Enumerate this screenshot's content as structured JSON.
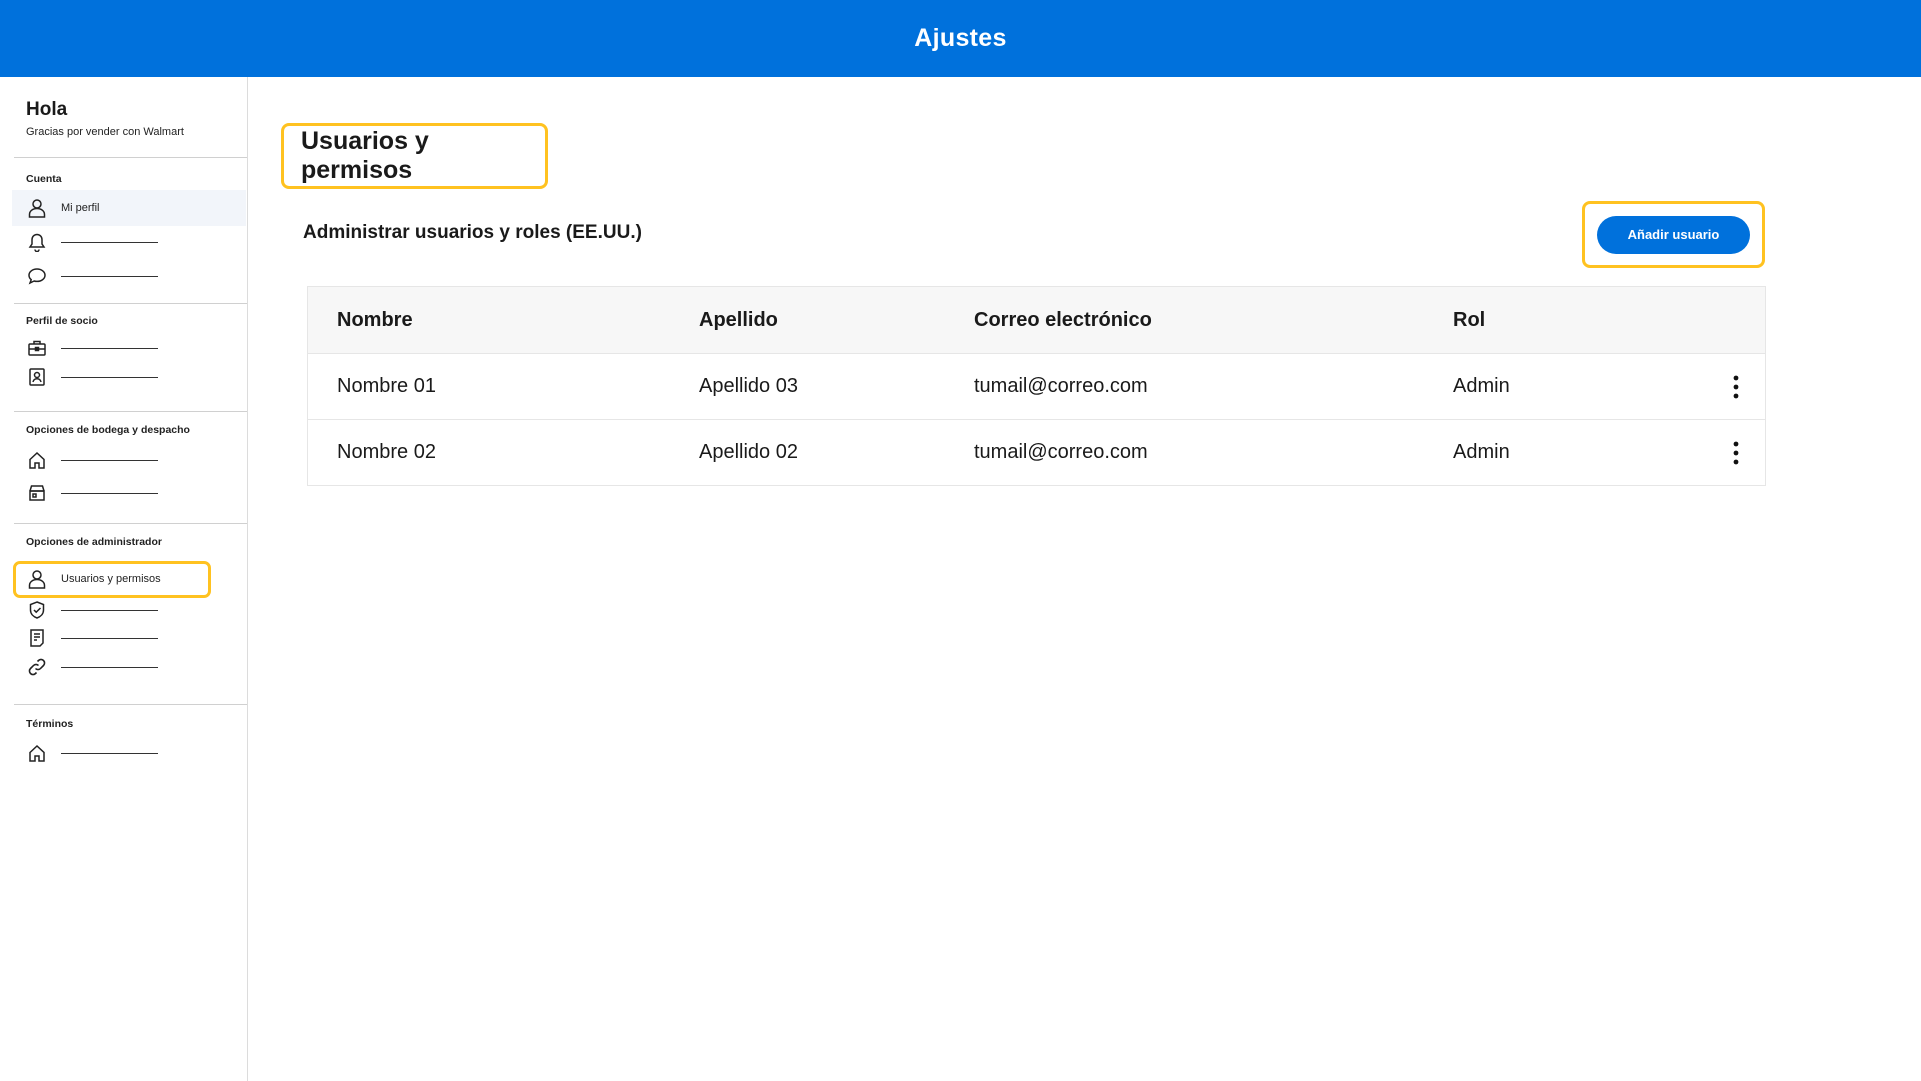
{
  "header": {
    "title": "Ajustes"
  },
  "sidebar": {
    "greeting": "Hola",
    "subgreeting": "Gracias por vender con Walmart",
    "sections": [
      {
        "title": "Cuenta",
        "items": [
          {
            "icon": "user-icon",
            "label": "Mi perfil"
          },
          {
            "icon": "bell-icon",
            "label": ""
          },
          {
            "icon": "chat-bubble-icon",
            "label": ""
          }
        ]
      },
      {
        "title": "Perfil de socio",
        "items": [
          {
            "icon": "briefcase-icon",
            "label": ""
          },
          {
            "icon": "id-badge-icon",
            "label": ""
          }
        ]
      },
      {
        "title": "Opciones de bodega y despacho",
        "items": [
          {
            "icon": "home-icon",
            "label": ""
          },
          {
            "icon": "store-icon",
            "label": ""
          }
        ]
      },
      {
        "title": "Opciones de administrador",
        "items": [
          {
            "icon": "user-icon",
            "label": "Usuarios y permisos"
          },
          {
            "icon": "shield-check-icon",
            "label": ""
          },
          {
            "icon": "document-icon",
            "label": ""
          },
          {
            "icon": "link-icon",
            "label": ""
          }
        ]
      },
      {
        "title": "Términos",
        "items": [
          {
            "icon": "home-icon",
            "label": ""
          }
        ]
      }
    ]
  },
  "main": {
    "title": "Usuarios y permisos",
    "subtitle": "Administrar usuarios y roles (EE.UU.)",
    "add_button": "Añadir usuario",
    "table": {
      "columns": [
        "Nombre",
        "Apellido",
        "Correo electrónico",
        "Rol"
      ],
      "rows": [
        [
          "Nombre 01",
          "Apellido 03",
          "tumail@correo.com",
          "Admin"
        ],
        [
          "Nombre 02",
          "Apellido 02",
          "tumail@correo.com",
          "Admin"
        ]
      ]
    }
  },
  "colors": {
    "brand": "#0071dc",
    "highlight": "#ffc220"
  }
}
